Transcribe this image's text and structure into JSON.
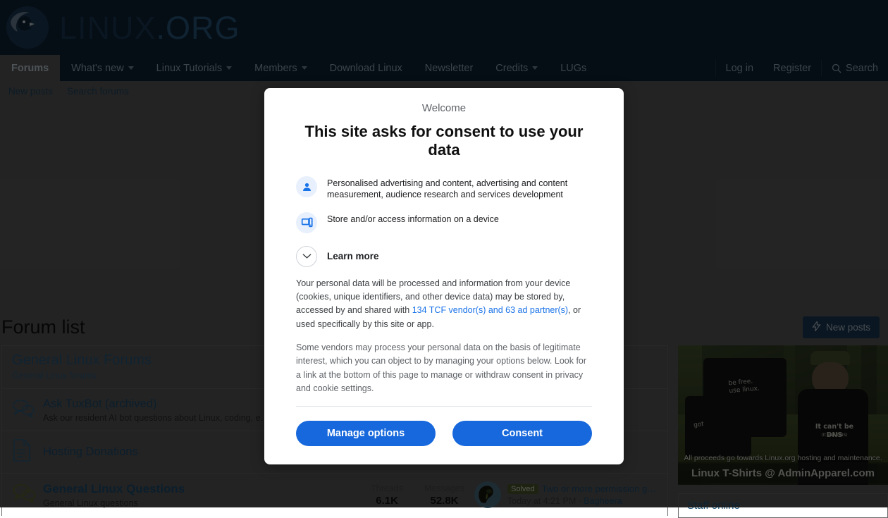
{
  "site": {
    "logo_text": "LINUX",
    "logo_suffix": ".ORG",
    "logo_icon": "penguin-globe-logo"
  },
  "nav": {
    "items": [
      {
        "label": "Forums",
        "active": true,
        "caret": false
      },
      {
        "label": "What's new",
        "active": false,
        "caret": true
      },
      {
        "label": "Linux Tutorials",
        "active": false,
        "caret": true
      },
      {
        "label": "Members",
        "active": false,
        "caret": true
      },
      {
        "label": "Download Linux",
        "active": false,
        "caret": false
      },
      {
        "label": "Newsletter",
        "active": false,
        "caret": false
      },
      {
        "label": "Credits",
        "active": false,
        "caret": true
      },
      {
        "label": "LUGs",
        "active": false,
        "caret": false
      }
    ],
    "login": "Log in",
    "register": "Register",
    "search": "Search",
    "search_icon": "search-icon"
  },
  "subnav": {
    "items": [
      {
        "label": "New posts"
      },
      {
        "label": "Search forums"
      }
    ]
  },
  "forum": {
    "page_title": "Forum list",
    "new_posts_button": "New posts",
    "new_posts_icon": "lightning-bolt-icon",
    "group": {
      "title": "General Linux Forums",
      "subtitle": "General Linux forums"
    },
    "nodes": [
      {
        "icon": "speech-bubbles-icon",
        "name": "Ask TuxBot (archived)",
        "description": "Ask our resident AI bot questions about Linux, coding, e…",
        "bold": false
      },
      {
        "icon": "document-icon",
        "name": "Hosting Donations",
        "description": "",
        "bold": false
      },
      {
        "icon": "speech-bubbles-icon",
        "name": "General Linux Questions",
        "description": "General Linux questions",
        "bold": true,
        "stats": [
          {
            "label": "Threads",
            "value": "6.1K"
          },
          {
            "label": "Messages",
            "value": "52.8K"
          }
        ],
        "last_post": {
          "avatar": "bagheera-avatar",
          "badge": "Solved",
          "title": "Two or more permission gr…",
          "time": "Today at 4:21 PM",
          "separator": "·",
          "author": "Bagheera"
        }
      }
    ]
  },
  "sidebar": {
    "ad": {
      "shirt_front_text": "be free.\nuse linux.",
      "shirt_back_text": "got linux?",
      "worn_shirt_text": "It can't be DNS",
      "worn_shirt_subtext": "(It was DNS)",
      "caption": "All proceeds go towards Linux.org hosting and maintenance.",
      "brand": "Linux T-Shirts @ AdminApparel.com"
    },
    "staff_online": "Staff online"
  },
  "modal": {
    "welcome": "Welcome",
    "title": "This site asks for consent to use your data",
    "purposes": [
      {
        "icon": "person-icon",
        "text": "Personalised advertising and content, advertising and content measurement, audience research and services development"
      },
      {
        "icon": "devices-icon",
        "text": "Store and/or access information on a device"
      }
    ],
    "learn_more": {
      "label": "Learn more",
      "icon": "chevron-down-icon"
    },
    "paragraph1_before": "Your personal data will be processed and information from your device (cookies, unique identifiers, and other device data) may be stored by, accessed by and shared with ",
    "paragraph1_link": "134 TCF vendor(s) and 63 ad partner(s)",
    "paragraph1_after": ", or used specifically by this site or app.",
    "paragraph2": "Some vendors may process your personal data on the basis of legitimate interest, which you can object to by managing your options below. Look for a link at the bottom of this page to manage or withdraw consent in privacy and cookie settings.",
    "manage_button": "Manage options",
    "consent_button": "Consent"
  },
  "colors": {
    "header_bg": "#0e2439",
    "accent_blue": "#1668dc",
    "link_blue": "#1a73e8",
    "overlay_gray": "#5e5e5e",
    "solved_badge": "#4e5a2e"
  }
}
